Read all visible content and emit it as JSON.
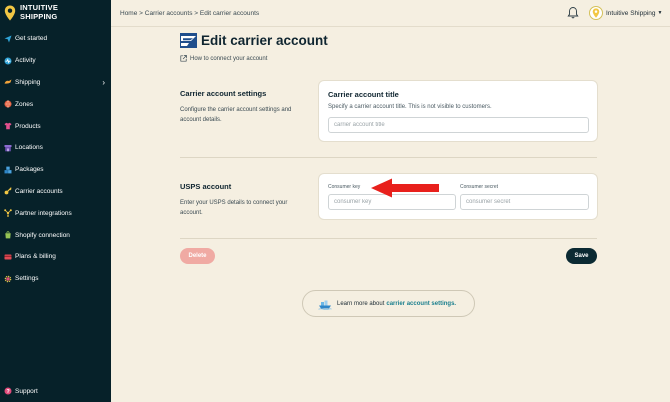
{
  "brand": {
    "line1": "INTUITIVE",
    "line2": "SHIPPING"
  },
  "sidebar": {
    "items": [
      {
        "label": "Get started",
        "icon": "send-icon"
      },
      {
        "label": "Activity",
        "icon": "activity-icon"
      },
      {
        "label": "Shipping",
        "icon": "shipping-icon",
        "has_chevron": true
      },
      {
        "label": "Zones",
        "icon": "globe-icon"
      },
      {
        "label": "Products",
        "icon": "shirt-icon"
      },
      {
        "label": "Locations",
        "icon": "store-icon"
      },
      {
        "label": "Packages",
        "icon": "boxes-icon"
      },
      {
        "label": "Carrier accounts",
        "icon": "key-icon"
      },
      {
        "label": "Partner integrations",
        "icon": "network-icon"
      },
      {
        "label": "Shopify connection",
        "icon": "shopify-icon"
      },
      {
        "label": "Plans & billing",
        "icon": "billing-icon"
      },
      {
        "label": "Settings",
        "icon": "gear-icon"
      }
    ],
    "support_label": "Support"
  },
  "topbar": {
    "breadcrumb": [
      "Home",
      "Carrier accounts",
      "Edit carrier accounts"
    ],
    "separator": ">",
    "account_name": "Intuitive Shipping"
  },
  "page": {
    "title": "Edit carrier account",
    "help_link": "How to connect your account"
  },
  "settings_section": {
    "title": "Carrier account settings",
    "description": "Configure the carrier account settings and account details.",
    "card_title": "Carrier account title",
    "card_subtitle": "Specify a carrier account title. This is not visible to customers.",
    "title_placeholder": "carrier account title",
    "title_value": ""
  },
  "usps_section": {
    "title": "USPS account",
    "description": "Enter your USPS details to connect your account.",
    "key_label": "Consumer key",
    "key_placeholder": "consumer key",
    "secret_label": "Consumer secret",
    "secret_placeholder": "consumer secret"
  },
  "actions": {
    "delete_label": "Delete",
    "save_label": "Save"
  },
  "learn_more": {
    "prefix": "Learn more about",
    "link": "carrier account settings."
  },
  "colors": {
    "sidebar_bg": "#062129",
    "page_bg": "#f5efe1",
    "brand_accent": "#f2c744",
    "delete_bg": "#f0aaa3",
    "save_bg": "#0b2a33",
    "link": "#1b7f8e",
    "arrow": "#e8201c"
  }
}
